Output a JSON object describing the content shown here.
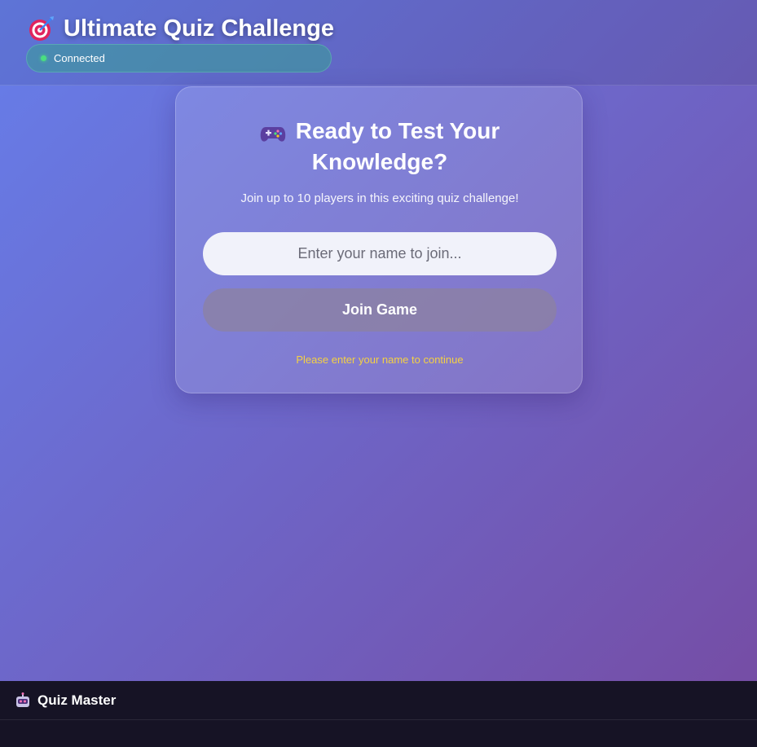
{
  "header": {
    "title": "Ultimate Quiz Challenge",
    "title_icon": "target-icon",
    "status_text": "Connected",
    "status_color": "#4ade80"
  },
  "card": {
    "title_icon": "gamepad-icon",
    "title_line1": "Ready to Test Your",
    "title_line2": "Knowledge?",
    "subtitle": "Join up to 10 players in this exciting quiz challenge!",
    "name_placeholder": "Enter your name to join...",
    "name_value": "",
    "join_label": "Join Game",
    "hint": "Please enter your name to continue",
    "hint_color": "#f5d142"
  },
  "footer": {
    "icon": "robot-icon",
    "label": "Quiz Master"
  },
  "colors": {
    "gradient_start": "#667eea",
    "gradient_end": "#764ba2"
  }
}
